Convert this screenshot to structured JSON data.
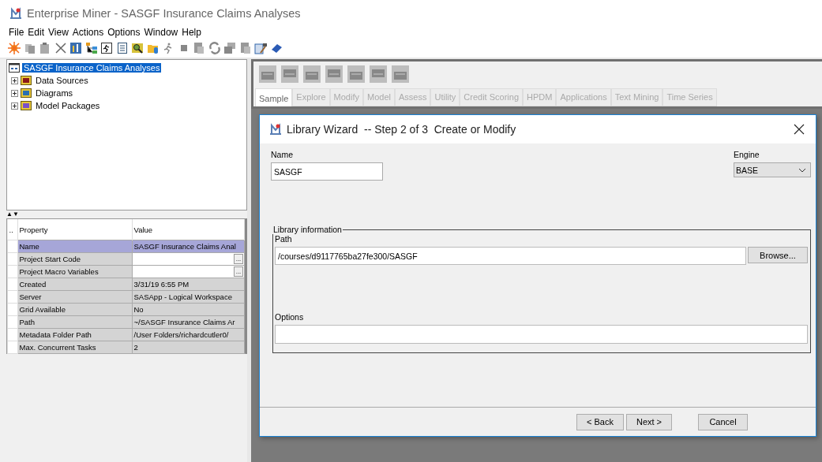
{
  "window": {
    "title": "Enterprise Miner - SASGF Insurance Claims Analyses"
  },
  "menu": [
    "File",
    "Edit",
    "View",
    "Actions",
    "Options",
    "Window",
    "Help"
  ],
  "project_tree": {
    "label": "SASGF Insurance Claims Analyses",
    "selected": true,
    "children": [
      {
        "label": "Data Sources",
        "expanded": false
      },
      {
        "label": "Diagrams",
        "expanded": false
      },
      {
        "label": "Model Packages",
        "expanded": false
      }
    ]
  },
  "splitter": {
    "label": "▲▼"
  },
  "properties": {
    "columns": [
      "..",
      "Property",
      "Value"
    ],
    "rows": [
      {
        "property": "Name",
        "value": "SASGF Insurance Claims Anal",
        "selected": true
      },
      {
        "property": "Project Start Code",
        "selected": false,
        "button": "..."
      },
      {
        "property": "Project Macro Variables",
        "selected": false,
        "button": "..."
      },
      {
        "property": "Created",
        "value": "3/31/19 6:55 PM",
        "selected": false
      },
      {
        "property": "Server",
        "value": "SASApp - Logical Workspace",
        "selected": false
      },
      {
        "property": "Grid Available",
        "value": "No",
        "selected": false
      },
      {
        "property": "Path",
        "value": "~/SASGF Insurance Claims Ar",
        "selected": false
      },
      {
        "property": "Metadata Folder Path",
        "value": "/User Folders/richardcutler0/",
        "selected": false
      },
      {
        "property": "Max. Concurrent Tasks",
        "value": "2",
        "selected": false
      }
    ]
  },
  "palette_tabs": [
    {
      "label": "Sample",
      "selected": true
    },
    {
      "label": "Explore",
      "selected": false
    },
    {
      "label": "Modify",
      "selected": false
    },
    {
      "label": "Model",
      "selected": false
    },
    {
      "label": "Assess",
      "selected": false
    },
    {
      "label": "Utility",
      "selected": false
    },
    {
      "label": "Credit Scoring",
      "selected": false
    },
    {
      "label": "HPDM",
      "selected": false
    },
    {
      "label": "Applications",
      "selected": false
    },
    {
      "label": "Text Mining",
      "selected": false
    },
    {
      "label": "Time Series",
      "selected": false
    }
  ],
  "dialog": {
    "title": "Library Wizard  -- Step 2 of 3  Create or Modify",
    "name": {
      "label": "Name",
      "value": "SASGF"
    },
    "engine": {
      "label": "Engine",
      "value": "BASE"
    },
    "group_title": "Library information",
    "path": {
      "label": "Path",
      "value": "/courses/d9117765ba27fe300/SASGF"
    },
    "browse_button": "Browse...",
    "options": {
      "label": "Options"
    },
    "buttons": [
      "< Back",
      "Next >",
      "Cancel"
    ]
  }
}
